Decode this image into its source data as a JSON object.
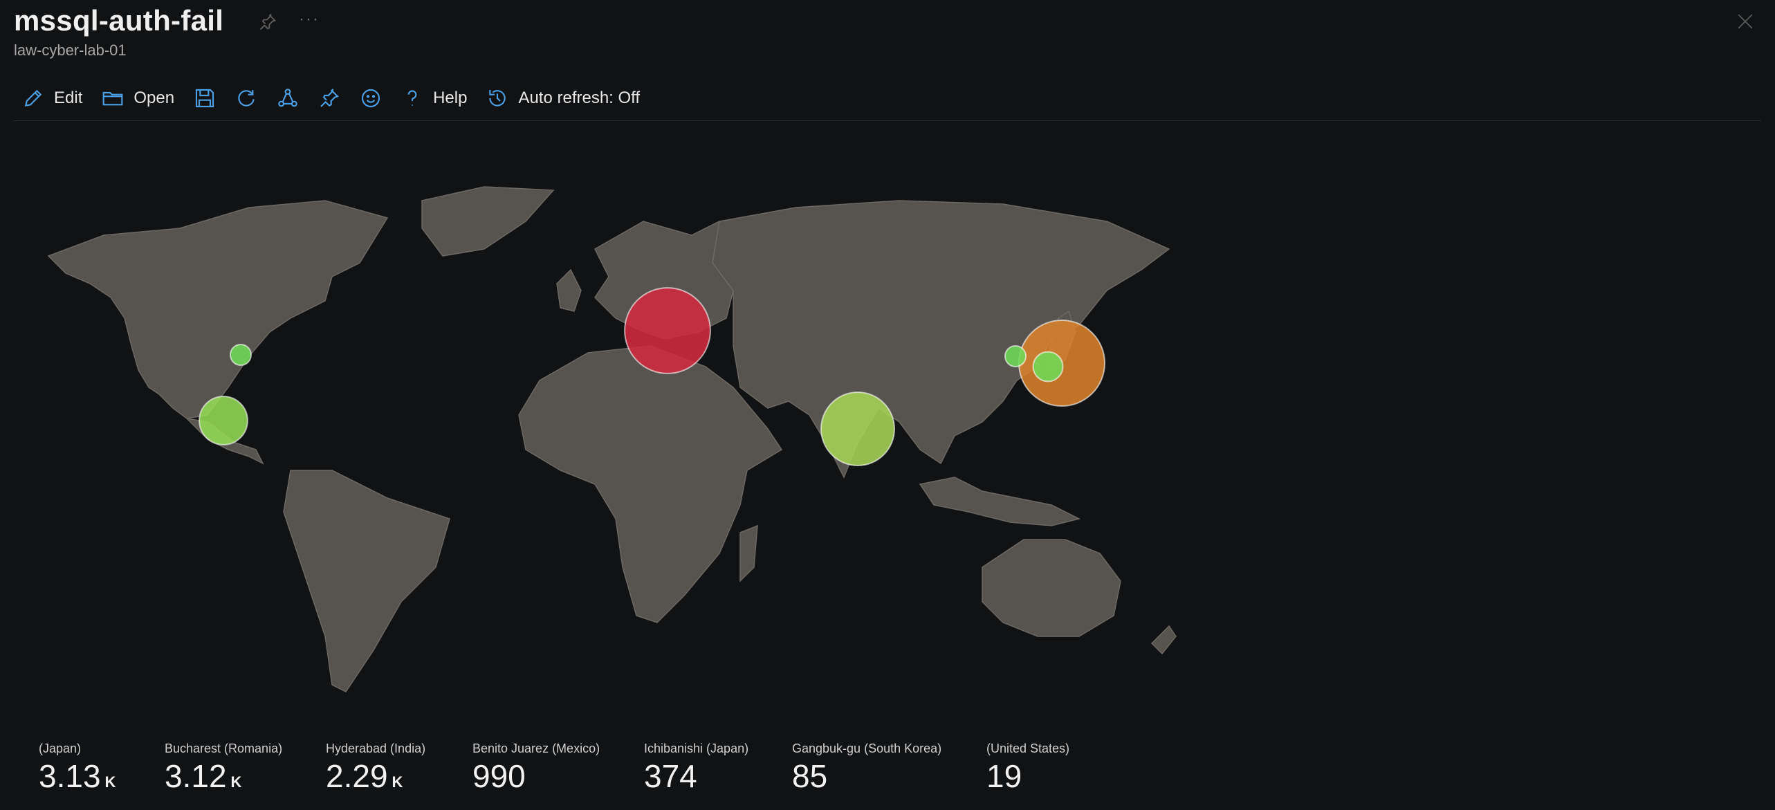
{
  "header": {
    "title": "mssql-auth-fail",
    "subtitle": "law-cyber-lab-01",
    "more": "···"
  },
  "toolbar": {
    "edit_label": "Edit",
    "open_label": "Open",
    "help_label": "Help",
    "autorefresh_label": "Auto refresh: Off"
  },
  "colors": {
    "accent": "#4aa0e6",
    "land": "#57534e",
    "red": "#d02a3f",
    "orange": "#d9822b",
    "yellowgreen": "#a6d456",
    "green": "#6ed957"
  },
  "map_points": [
    {
      "location": "(Japan)",
      "value": 3130,
      "color": "#d9822b"
    },
    {
      "location": "Bucharest (Romania)",
      "value": 3120,
      "color": "#d02a3f"
    },
    {
      "location": "Hyderabad (India)",
      "value": 2290,
      "color": "#a6d456"
    },
    {
      "location": "Benito Juarez (Mexico)",
      "value": 990,
      "color": "#93db54"
    },
    {
      "location": "Ichibanishi (Japan)",
      "value": 374,
      "color": "#6ed957"
    },
    {
      "location": "Gangbuk-gu (South Korea)",
      "value": 85,
      "color": "#6ed957"
    },
    {
      "location": "(United States)",
      "value": 19,
      "color": "#6ed957"
    }
  ],
  "tiles": [
    {
      "label": "(Japan)",
      "value": "3.13",
      "unit": "K"
    },
    {
      "label": "Bucharest (Romania)",
      "value": "3.12",
      "unit": "K"
    },
    {
      "label": "Hyderabad (India)",
      "value": "2.29",
      "unit": "K"
    },
    {
      "label": "Benito Juarez (Mexico)",
      "value": "990",
      "unit": ""
    },
    {
      "label": "Ichibanishi (Japan)",
      "value": "374",
      "unit": ""
    },
    {
      "label": "Gangbuk-gu (South Korea)",
      "value": "85",
      "unit": ""
    },
    {
      "label": "(United States)",
      "value": "19",
      "unit": ""
    }
  ]
}
